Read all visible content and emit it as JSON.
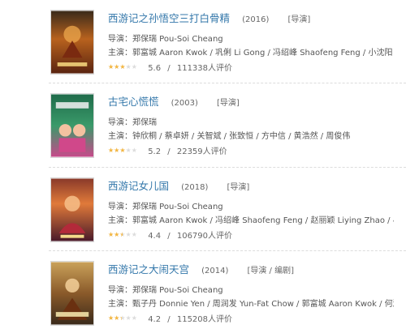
{
  "colors": {
    "link": "#3377aa",
    "star": "#f4b63f",
    "star_empty": "#dcdcdc",
    "divider": "#dcdcdc"
  },
  "movies": [
    {
      "title": "西游记之孙悟空三打白骨精",
      "year": "(2016)",
      "role": "[导演]",
      "director": "导演：郑保瑞 Pou-Soi Cheang",
      "cast": "主演：郭富城 Aaron Kwok / 巩俐 Li Gong / 冯绍峰 Shaofeng Feng / 小沈阳 Xiao Sh...",
      "rating": "5.6",
      "star_fraction": 0.56,
      "votes": "111338人评价",
      "rating_sep": "/"
    },
    {
      "title": "古宅心慌慌",
      "year": "(2003)",
      "role": "[导演]",
      "director": "导演：郑保瑞",
      "cast": "主演：钟欣桐 / 蔡卓妍 / 关智斌 / 张致恒 / 方中信 / 黄浩然 / 周俊伟",
      "rating": "5.2",
      "star_fraction": 0.52,
      "votes": "22359人评价",
      "rating_sep": "/"
    },
    {
      "title": "西游记女儿国",
      "year": "(2018)",
      "role": "[导演]",
      "director": "导演：郑保瑞 Pou-Soi Cheang",
      "cast": "主演：郭富城 Aaron Kwok / 冯绍峰 Shaofeng Feng / 赵丽颖 Liying Zhao / 小沈阳 Xia...",
      "rating": "4.4",
      "star_fraction": 0.44,
      "votes": "106790人评价",
      "rating_sep": "/"
    },
    {
      "title": "西游记之大闹天宫",
      "year": "(2014)",
      "role": "[导演 / 编剧]",
      "director": "导演：郑保瑞 Pou-Soi Cheang",
      "cast": "主演：甄子丹 Donnie Yen / 周润发 Yun-Fat Chow / 郭富城 Aaron Kwok / 何润东 Pet...",
      "rating": "4.2",
      "star_fraction": 0.42,
      "votes": "115208人评价",
      "rating_sep": "/"
    }
  ]
}
